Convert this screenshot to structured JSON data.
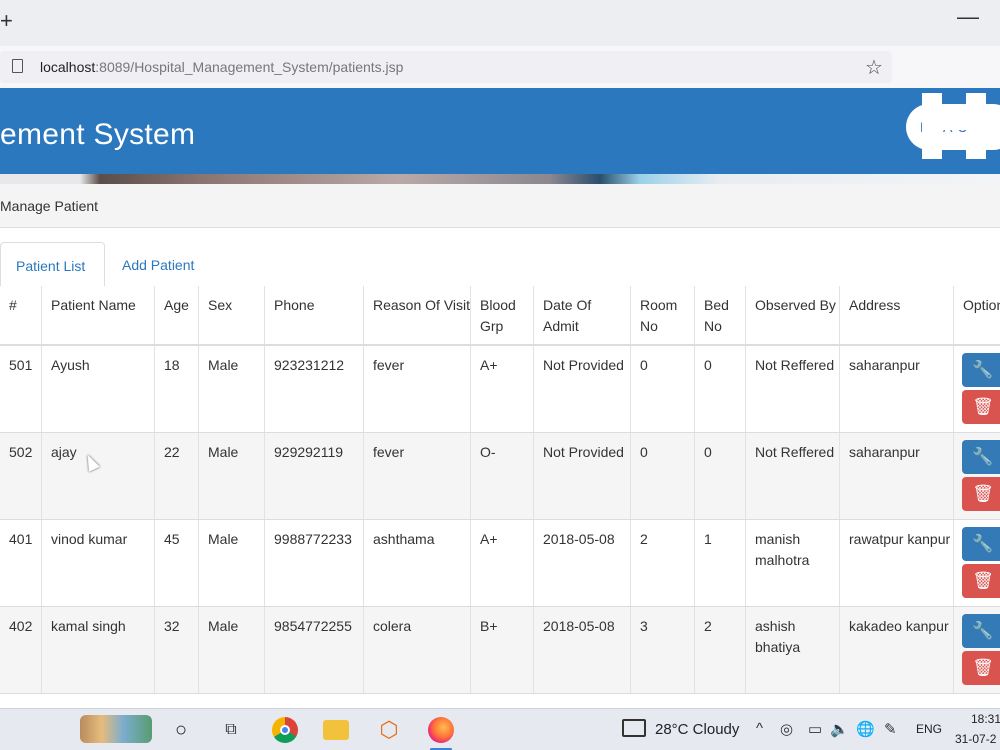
{
  "browser": {
    "new_tab_label": "+",
    "minimize_label": "—",
    "url_host": "localhost",
    "url_rest": ":8089/Hospital_Management_System/patients.jsp",
    "bookmark_icon": "☆"
  },
  "header": {
    "title": "ement System",
    "logo_text": "NOA UN"
  },
  "breadcrumb": "Manage Patient",
  "tabs": [
    {
      "label": "Patient List",
      "active": true
    },
    {
      "label": "Add Patient",
      "active": false
    }
  ],
  "table": {
    "columns": [
      "#",
      "Patient Name",
      "Age",
      "Sex",
      "Phone",
      "Reason Of Visit",
      "Blood Grp",
      "Date Of Admit",
      "Room No",
      "Bed No",
      "Observed By",
      "Address",
      "Options"
    ],
    "rows": [
      [
        "501",
        "Ayush",
        "18",
        "Male",
        "923231212",
        "fever",
        "A+",
        "Not Provided",
        "0",
        "0",
        "Not Reffered",
        "saharanpur"
      ],
      [
        "502",
        "ajay",
        "22",
        "Male",
        "929292119",
        "fever",
        "O-",
        "Not Provided",
        "0",
        "0",
        "Not Reffered",
        "saharanpur"
      ],
      [
        "401",
        "vinod kumar",
        "45",
        "Male",
        "9988772233",
        "ashthama",
        "A+",
        "2018-05-08",
        "2",
        "1",
        "manish malhotra",
        "rawatpur kanpur"
      ],
      [
        "402",
        "kamal singh",
        "32",
        "Male",
        "9854772255",
        "colera",
        "B+",
        "2018-05-08",
        "3",
        "2",
        "ashish bhatiya",
        "kakadeo kanpur"
      ]
    ],
    "edit_icon": "wrench-icon",
    "delete_icon": "trash-icon"
  },
  "taskbar": {
    "weather": "28°C  Cloudy",
    "language": "ENG",
    "time": "18:31",
    "date": "31-07-2"
  },
  "colors": {
    "header_blue": "#2b78bf",
    "edit_button": "#337ab7",
    "delete_button": "#d9534f",
    "link": "#2b78bf"
  }
}
